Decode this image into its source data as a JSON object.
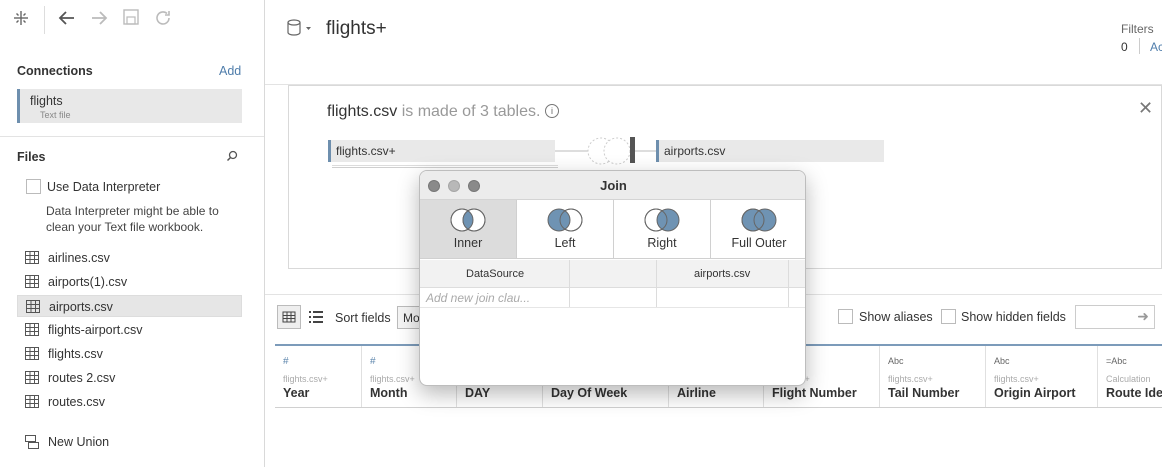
{
  "sidebar": {
    "connections_title": "Connections",
    "add_label": "Add",
    "connection": {
      "name": "flights",
      "type": "Text file"
    },
    "files_title": "Files",
    "data_interpreter_label": "Use Data Interpreter",
    "data_interpreter_desc": "Data Interpreter might be able to clean your Text file workbook.",
    "files": [
      {
        "name": "airlines.csv"
      },
      {
        "name": "airports(1).csv"
      },
      {
        "name": "airports.csv"
      },
      {
        "name": "flights-airport.csv"
      },
      {
        "name": "flights.csv"
      },
      {
        "name": "routes 2.csv"
      },
      {
        "name": "routes.csv"
      }
    ],
    "new_union_label": "New Union"
  },
  "header": {
    "title": "flights+",
    "filters_label": "Filters",
    "filters_count": "0",
    "filters_add": "Ac"
  },
  "canvas": {
    "title_main": "flights.csv",
    "title_sub": " is made of 3 tables.",
    "left_table": "flights.csv+",
    "right_table": "airports.csv"
  },
  "toolbar": {
    "sort_label": "Sort fields",
    "sort_value": "Mo",
    "show_aliases": "Show aliases",
    "show_hidden": "Show hidden fields"
  },
  "columns": [
    {
      "type": "#",
      "source": "flights.csv+",
      "name": "Year"
    },
    {
      "type": "#",
      "source": "flights.csv+",
      "name": "Month"
    },
    {
      "type": "",
      "source": "",
      "name": "DAY"
    },
    {
      "type": "",
      "source": "",
      "name": "Day Of Week"
    },
    {
      "type": "",
      "source": "",
      "name": "Airline"
    },
    {
      "type": "",
      "source": "v+",
      "name": "Flight Number"
    },
    {
      "type": "Abc",
      "source": "flights.csv+",
      "name": "Tail Number"
    },
    {
      "type": "Abc",
      "source": "flights.csv+",
      "name": "Origin Airport"
    },
    {
      "type": "=Abc",
      "source": "Calculation",
      "name": "Route Iden"
    }
  ],
  "join_dialog": {
    "title": "Join",
    "types": [
      {
        "label": "Inner",
        "selected": true
      },
      {
        "label": "Left",
        "selected": false
      },
      {
        "label": "Right",
        "selected": false
      },
      {
        "label": "Full Outer",
        "selected": false
      }
    ],
    "left_header": "DataSource",
    "right_header": "airports.csv",
    "add_clause_placeholder": "Add new join clau..."
  },
  "colors": {
    "accent": "#6e8fae",
    "venn_fill": "#6f93b3",
    "link": "#4f7dab"
  }
}
